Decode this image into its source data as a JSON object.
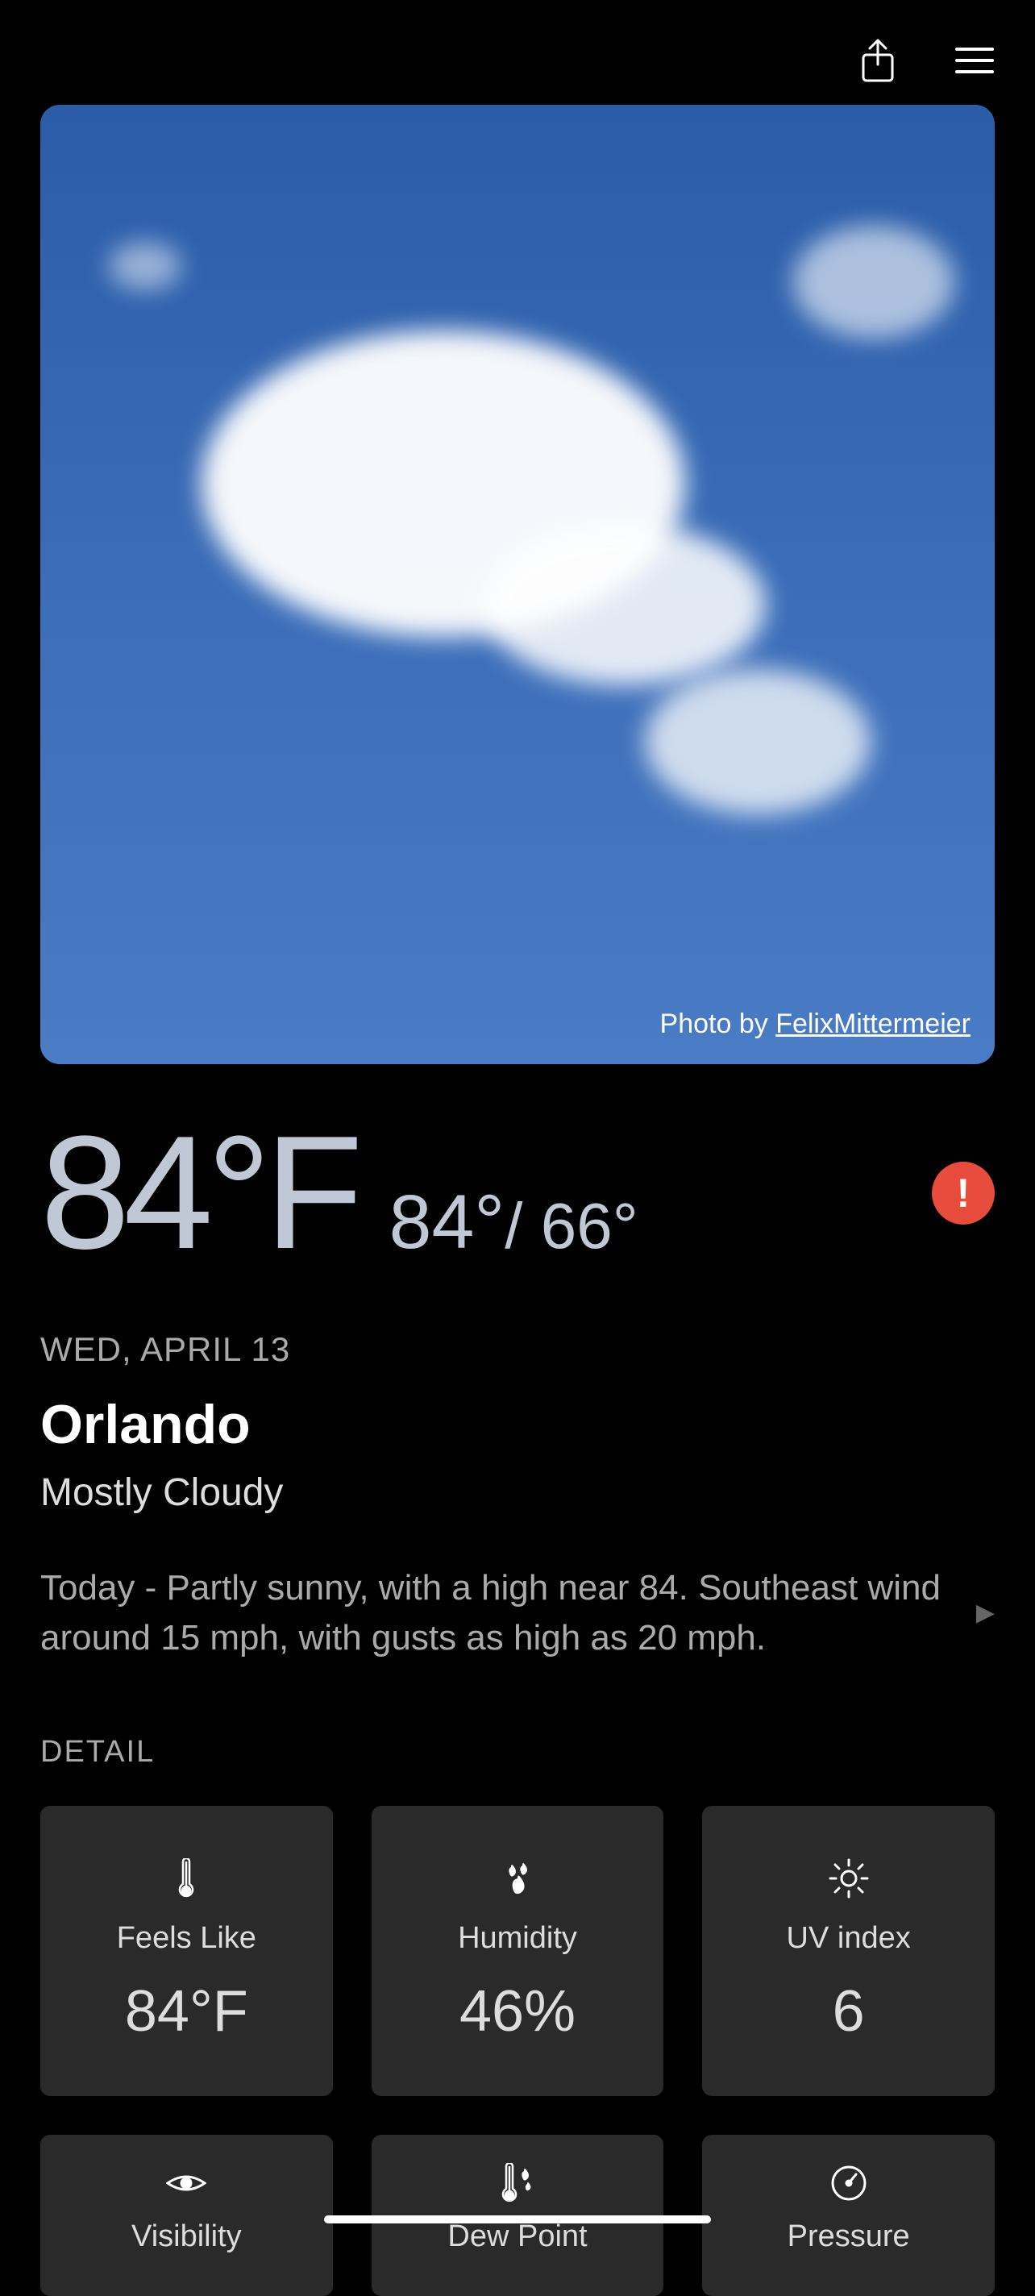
{
  "header": {
    "share_label": "Share",
    "menu_label": "Menu"
  },
  "hero": {
    "credit_prefix": "Photo by ",
    "credit_name": "FelixMittermeier"
  },
  "current": {
    "temp": "84°F",
    "high": "84°",
    "low": "66°",
    "date": "WED, APRIL 13",
    "location": "Orlando",
    "condition": "Mostly Cloudy",
    "forecast": "Today - Partly sunny, with a high near 84. Southeast wind around 15 mph, with gusts as high as 20 mph.",
    "alert": "!"
  },
  "section": {
    "detail": "DETAIL"
  },
  "details": {
    "feels_like": {
      "label": "Feels Like",
      "value": "84°F"
    },
    "humidity": {
      "label": "Humidity",
      "value": "46%"
    },
    "uv_index": {
      "label": "UV index",
      "value": "6"
    },
    "visibility": {
      "label": "Visibility"
    },
    "dew_point": {
      "label": "Dew Point"
    },
    "pressure": {
      "label": "Pressure"
    }
  }
}
